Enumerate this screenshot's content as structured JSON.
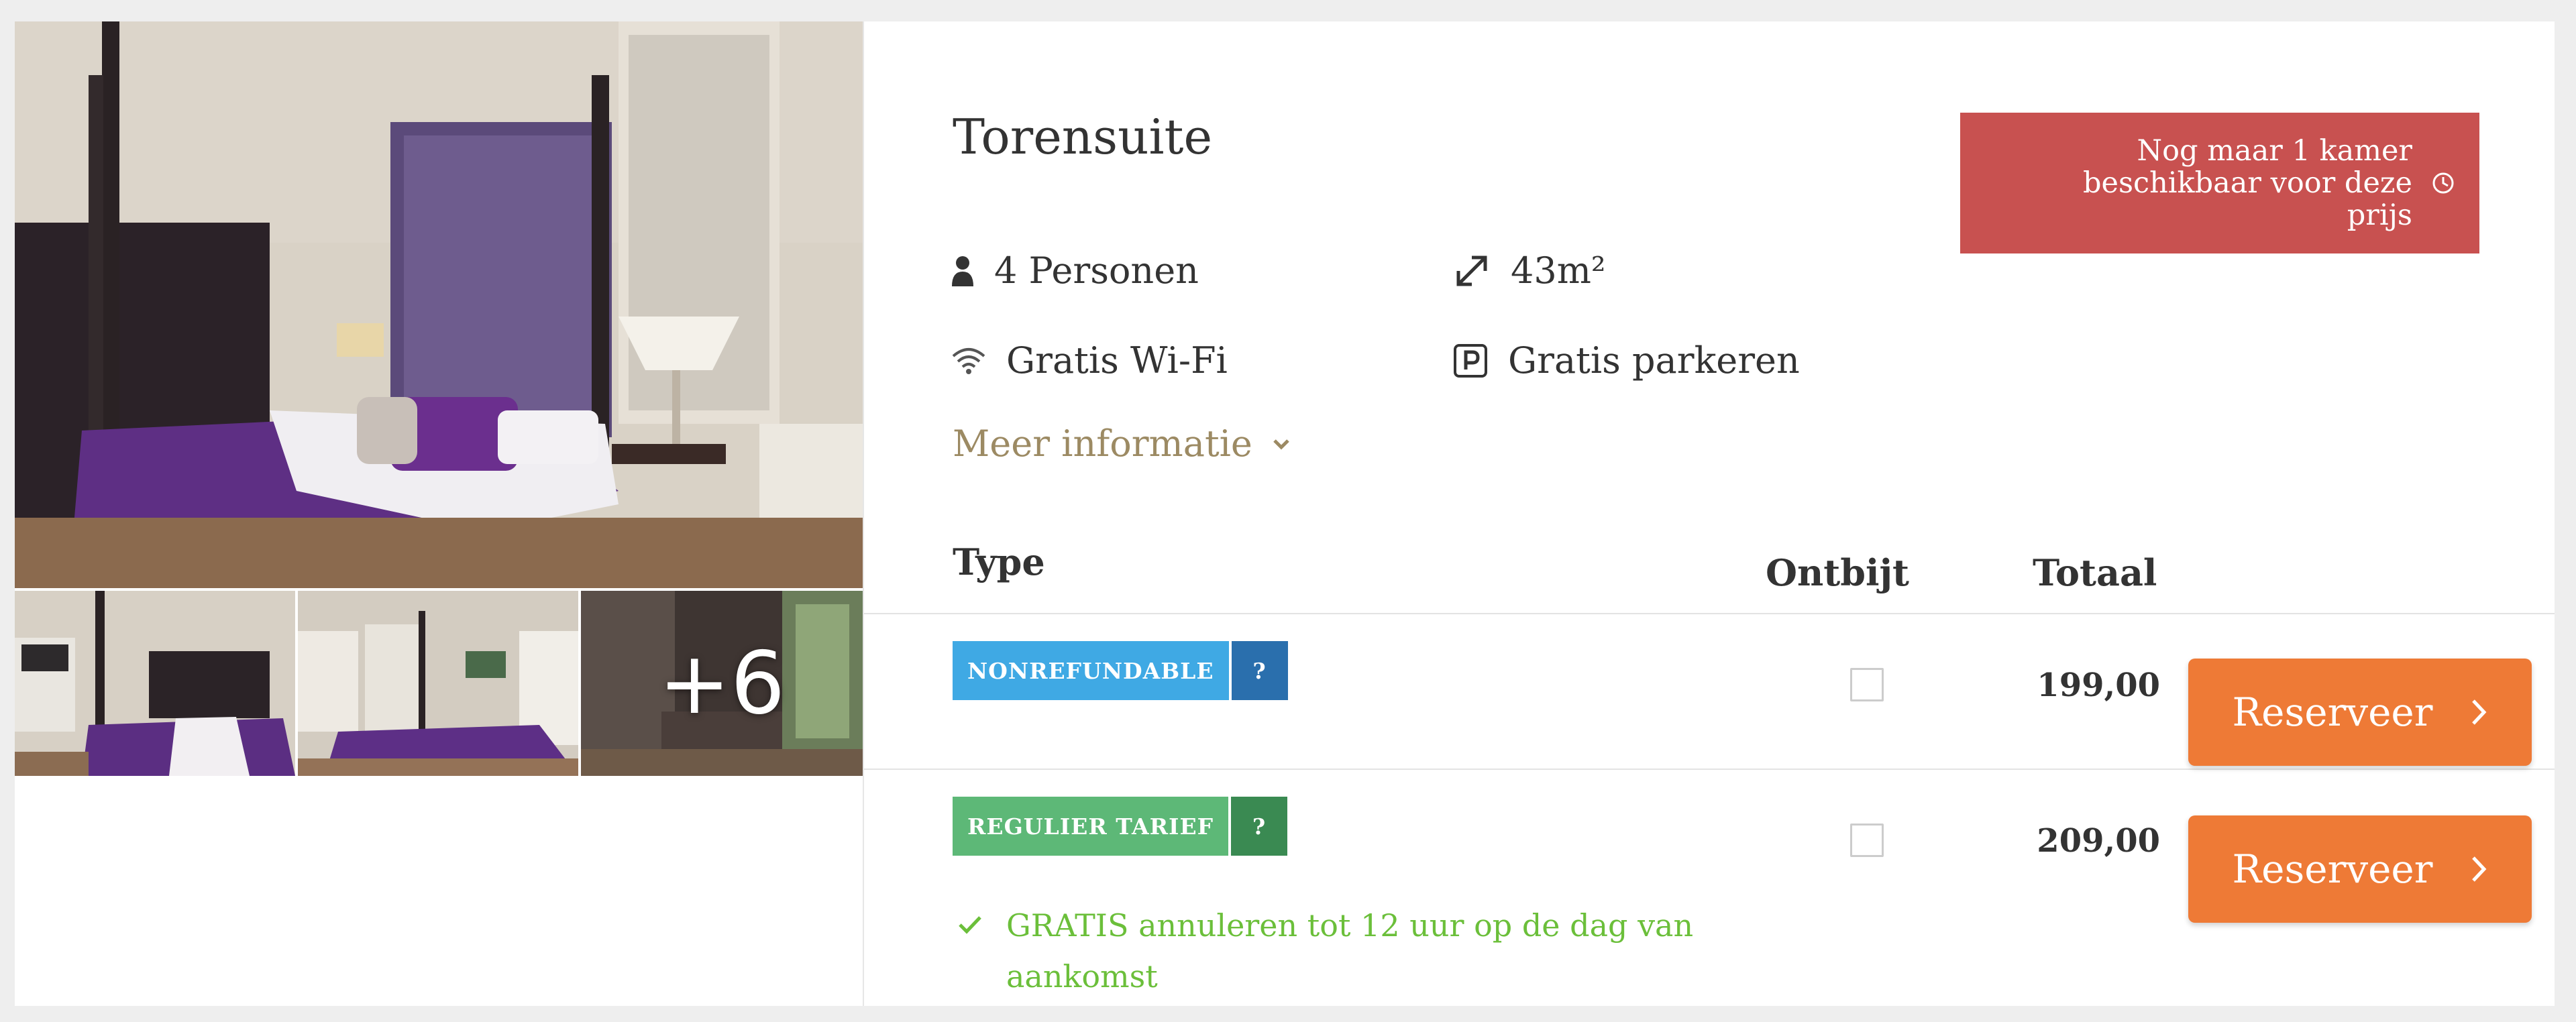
{
  "room": {
    "title": "Torensuite",
    "features": {
      "persons": {
        "icon": "person-icon",
        "label": "4 Personen"
      },
      "size": {
        "icon": "expand-arrows-icon",
        "label": "43m²"
      },
      "wifi": {
        "icon": "wifi-icon",
        "label": "Gratis Wi-Fi"
      },
      "parking": {
        "icon": "parking-icon",
        "label": "Gratis parkeren"
      }
    },
    "more_info_label": "Meer informatie"
  },
  "availability": {
    "text": "Nog maar 1 kamer beschikbaar voor deze prijs",
    "icon": "clock-icon",
    "color": "#c85150"
  },
  "gallery": {
    "more_photos_label": "+6"
  },
  "table": {
    "headers": {
      "type": "Type",
      "breakfast": "Ontbijt",
      "total": "Totaal"
    },
    "rates": [
      {
        "tag": "NONREFUNDABLE",
        "help": "?",
        "tag_color": "#3fa9e4",
        "breakfast_checked": false,
        "price": "199,00",
        "button_label": "Reserveer"
      },
      {
        "tag": "REGULIER TARIEF",
        "help": "?",
        "tag_color": "#5db877",
        "breakfast_checked": false,
        "price": "209,00",
        "button_label": "Reserveer",
        "note": "GRATIS annuleren tot 12 uur op de dag van aankomst"
      }
    ]
  },
  "colors": {
    "accent_button": "#ee7a36",
    "more_info": "#9c8a63",
    "cancel_note": "#6bbf3a"
  }
}
